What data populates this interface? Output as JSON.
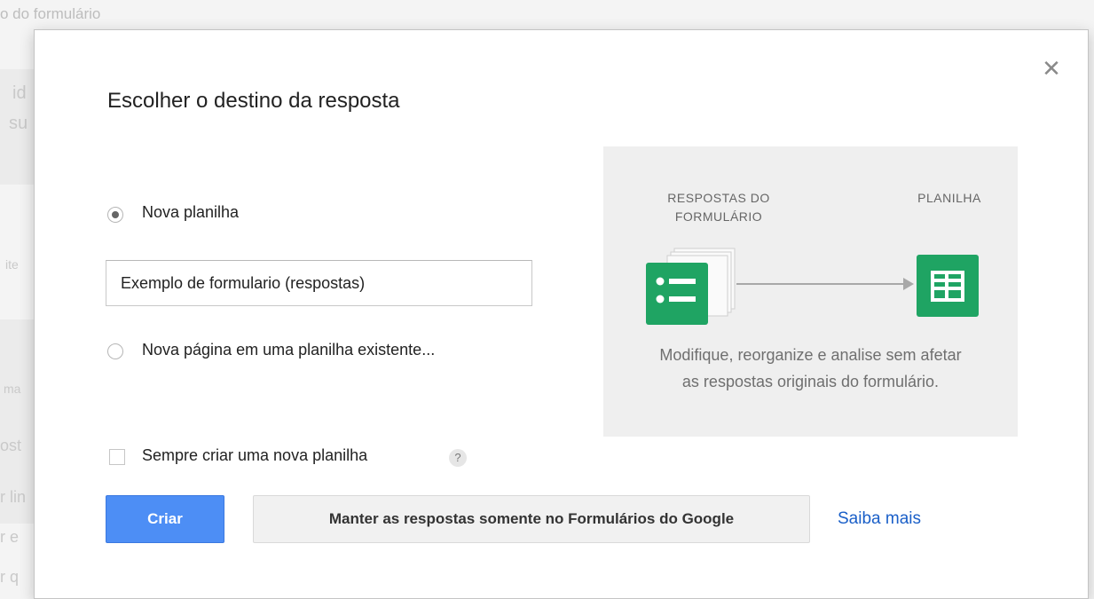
{
  "background": {
    "top_text": "o do formulário",
    "side_fragments": [
      "id",
      "su",
      "ite",
      "ma",
      "ost",
      "r lin",
      "r e",
      "r q"
    ]
  },
  "dialog": {
    "title": "Escolher o destino da resposta",
    "close_icon": "close-icon",
    "options": {
      "new_sheet_label": "Nova planilha",
      "new_sheet_selected": true,
      "sheet_name_value": "Exemplo de formulario (respostas)",
      "existing_sheet_label": "Nova página em uma planilha existente...",
      "existing_sheet_selected": false
    },
    "always_create": {
      "label": "Sempre criar uma nova planilha",
      "checked": false,
      "help_glyph": "?"
    },
    "buttons": {
      "create": "Criar",
      "keep_in_forms": "Manter as respostas somente no Formulários do Google",
      "learn_more": "Saiba mais"
    },
    "illustration": {
      "left_caption_line1": "RESPOSTAS DO",
      "left_caption_line2": "FORMULÁRIO",
      "right_caption": "PLANILHA",
      "forms_icon": "google-forms-icon",
      "sheets_icon": "google-sheets-icon",
      "description_line1": "Modifique, reorganize e analise sem afetar",
      "description_line2": "as respostas originais do formulário."
    }
  },
  "colors": {
    "primary_button": "#4d8ef5",
    "link": "#1a5fc8",
    "google_green": "#1fa463",
    "panel_bg": "#efefef"
  }
}
